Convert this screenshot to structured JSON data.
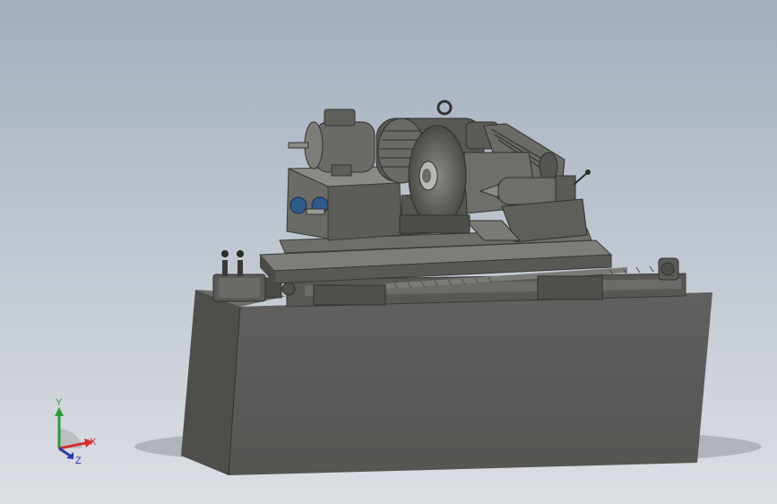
{
  "viewport": {
    "background_top": "#a2aebd",
    "background_bottom": "#dcdfe4"
  },
  "model": {
    "body_color": "#5e5e5b",
    "bolt_color": "#2e5a8a"
  },
  "triad": {
    "x_label": "X",
    "y_label": "Y",
    "z_label": "Z",
    "x_color": "#d23030",
    "y_color": "#2e9a3a",
    "z_color": "#2a3aa8"
  }
}
